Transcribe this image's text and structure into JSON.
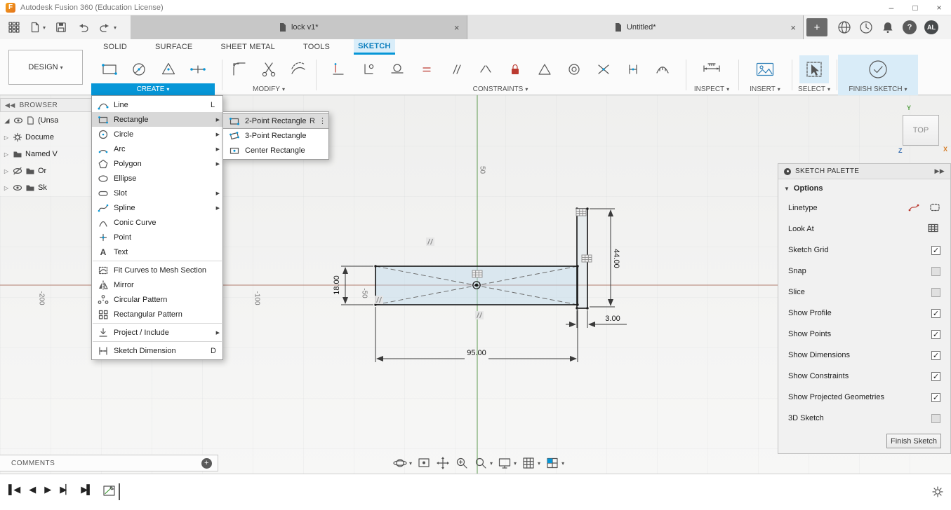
{
  "titlebar": {
    "title": "Autodesk Fusion 360 (Education License)"
  },
  "doc_tabs": {
    "tab1": "lock v1*",
    "tab2": "Untitled*"
  },
  "topbar": {
    "help_glyph": "?",
    "avatar_initials": "AL"
  },
  "ribbon": {
    "design_label": "DESIGN",
    "tabs": [
      {
        "label": "SOLID"
      },
      {
        "label": "SURFACE"
      },
      {
        "label": "SHEET METAL"
      },
      {
        "label": "TOOLS"
      },
      {
        "label": "SKETCH"
      }
    ],
    "groups": {
      "create": "CREATE",
      "modify": "MODIFY",
      "constraints": "CONSTRAINTS",
      "inspect": "INSPECT",
      "insert": "INSERT",
      "select": "SELECT",
      "finish": "FINISH SKETCH"
    }
  },
  "create_menu": {
    "items": [
      {
        "label": "Line",
        "shortcut": "L"
      },
      {
        "label": "Rectangle",
        "shortcut": ""
      },
      {
        "label": "Circle",
        "shortcut": ""
      },
      {
        "label": "Arc",
        "shortcut": ""
      },
      {
        "label": "Polygon",
        "shortcut": ""
      },
      {
        "label": "Ellipse",
        "shortcut": ""
      },
      {
        "label": "Slot",
        "shortcut": ""
      },
      {
        "label": "Spline",
        "shortcut": ""
      },
      {
        "label": "Conic Curve",
        "shortcut": ""
      },
      {
        "label": "Point",
        "shortcut": ""
      },
      {
        "label": "Text",
        "shortcut": ""
      },
      {
        "label": "Fit Curves to Mesh Section",
        "shortcut": ""
      },
      {
        "label": "Mirror",
        "shortcut": ""
      },
      {
        "label": "Circular Pattern",
        "shortcut": ""
      },
      {
        "label": "Rectangular Pattern",
        "shortcut": ""
      },
      {
        "label": "Project / Include",
        "shortcut": ""
      },
      {
        "label": "Sketch Dimension",
        "shortcut": "D"
      }
    ]
  },
  "rect_submenu": {
    "items": [
      {
        "label": "2-Point Rectangle",
        "shortcut": "R"
      },
      {
        "label": "3-Point Rectangle",
        "shortcut": ""
      },
      {
        "label": "Center Rectangle",
        "shortcut": ""
      }
    ]
  },
  "browser": {
    "header": "BROWSER",
    "items": [
      {
        "label": "(Unsa"
      },
      {
        "label": "Docume"
      },
      {
        "label": "Named V"
      },
      {
        "label": "Or"
      },
      {
        "label": "Sk"
      }
    ]
  },
  "palette": {
    "header": "SKETCH PALETTE",
    "options_label": "Options",
    "rows": [
      {
        "label": "Linetype",
        "checked": null
      },
      {
        "label": "Look At",
        "checked": null
      },
      {
        "label": "Sketch Grid",
        "checked": true
      },
      {
        "label": "Snap",
        "checked": false
      },
      {
        "label": "Slice",
        "checked": false
      },
      {
        "label": "Show Profile",
        "checked": true
      },
      {
        "label": "Show Points",
        "checked": true
      },
      {
        "label": "Show Dimensions",
        "checked": true
      },
      {
        "label": "Show Constraints",
        "checked": true
      },
      {
        "label": "Show Projected Geometries",
        "checked": true
      },
      {
        "label": "3D Sketch",
        "checked": false
      }
    ],
    "finish_button": "Finish Sketch"
  },
  "canvas": {
    "viewcube_face": "TOP",
    "axis_x": "X",
    "axis_y": "Y",
    "axis_z": "Z",
    "dim_width": "95.00",
    "dim_height": "18.00",
    "dim_side": "44.00",
    "dim_thickness": "3.00",
    "tick_y_50": "50",
    "tick_x_m50": "-50",
    "tick_x_m100": "-100",
    "tick_x_m200": "-200"
  },
  "comments": {
    "label": "COMMENTS"
  }
}
